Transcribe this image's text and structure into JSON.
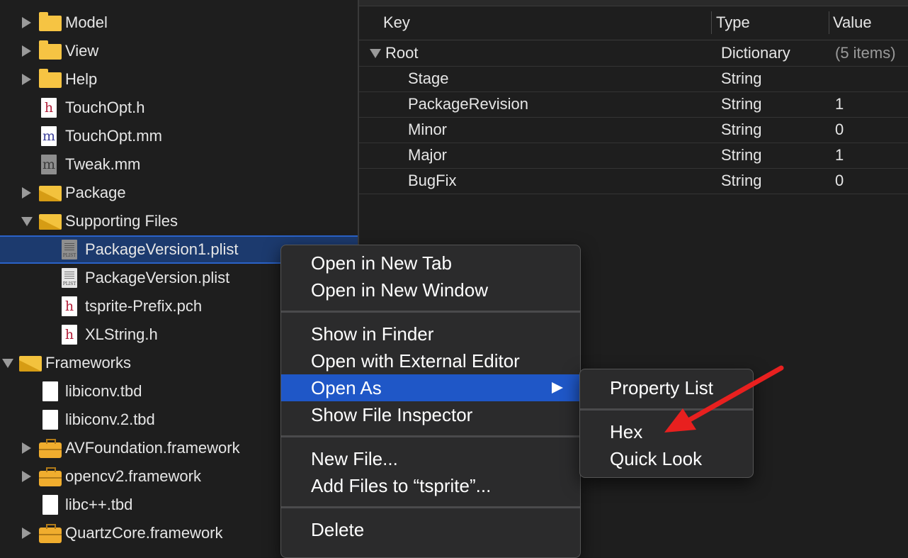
{
  "navigator": {
    "items": [
      {
        "label": "Model",
        "icon": "folder-icon"
      },
      {
        "label": "View",
        "icon": "folder-icon"
      },
      {
        "label": "Help",
        "icon": "folder-icon"
      },
      {
        "label": "TouchOpt.h",
        "icon": "header-file-icon",
        "glyph": "h"
      },
      {
        "label": "TouchOpt.mm",
        "icon": "objc-file-icon",
        "glyph": "m"
      },
      {
        "label": "Tweak.mm",
        "icon": "objc-file-icon",
        "glyph": "m"
      },
      {
        "label": "Package",
        "icon": "group-folder-icon"
      },
      {
        "label": "Supporting Files",
        "icon": "group-folder-icon"
      },
      {
        "label": "PackageVersion1.plist",
        "icon": "plist-file-icon",
        "selected": true
      },
      {
        "label": "PackageVersion.plist",
        "icon": "plist-file-icon"
      },
      {
        "label": "tsprite-Prefix.pch",
        "icon": "header-file-icon",
        "glyph": "h"
      },
      {
        "label": "XLString.h",
        "icon": "header-file-icon",
        "glyph": "h"
      },
      {
        "label": "Frameworks",
        "icon": "group-folder-icon"
      },
      {
        "label": "libiconv.tbd",
        "icon": "tbd-file-icon"
      },
      {
        "label": "libiconv.2.tbd",
        "icon": "tbd-file-icon"
      },
      {
        "label": "AVFoundation.framework",
        "icon": "framework-icon"
      },
      {
        "label": "opencv2.framework",
        "icon": "framework-icon"
      },
      {
        "label": "libc++.tbd",
        "icon": "tbd-file-icon"
      },
      {
        "label": "QuartzCore.framework",
        "icon": "framework-icon"
      }
    ],
    "plist_badge": "PLIST"
  },
  "editor": {
    "columns": {
      "key": "Key",
      "type": "Type",
      "value": "Value"
    },
    "root": {
      "key": "Root",
      "type": "Dictionary",
      "value": "(5 items)"
    },
    "rows": [
      {
        "key": "Stage",
        "type": "String",
        "value": ""
      },
      {
        "key": "PackageRevision",
        "type": "String",
        "value": "1"
      },
      {
        "key": "Minor",
        "type": "String",
        "value": "0"
      },
      {
        "key": "Major",
        "type": "String",
        "value": "1"
      },
      {
        "key": "BugFix",
        "type": "String",
        "value": "0"
      }
    ]
  },
  "context_menu": {
    "open_new_tab": "Open in New Tab",
    "open_new_window": "Open in New Window",
    "show_in_finder": "Show in Finder",
    "open_external_editor": "Open with External Editor",
    "open_as": "Open As",
    "show_file_inspector": "Show File Inspector",
    "new_file": "New File...",
    "add_files": "Add Files to “tsprite”...",
    "delete": "Delete"
  },
  "submenu": {
    "property_list": "Property List",
    "hex": "Hex",
    "quick_look": "Quick Look"
  },
  "colors": {
    "background": "#1e1e1e",
    "selection": "#1c3a6e",
    "menu_highlight": "#1f57c7",
    "annotation_arrow": "#e8201f",
    "folder": "#f6c443"
  }
}
